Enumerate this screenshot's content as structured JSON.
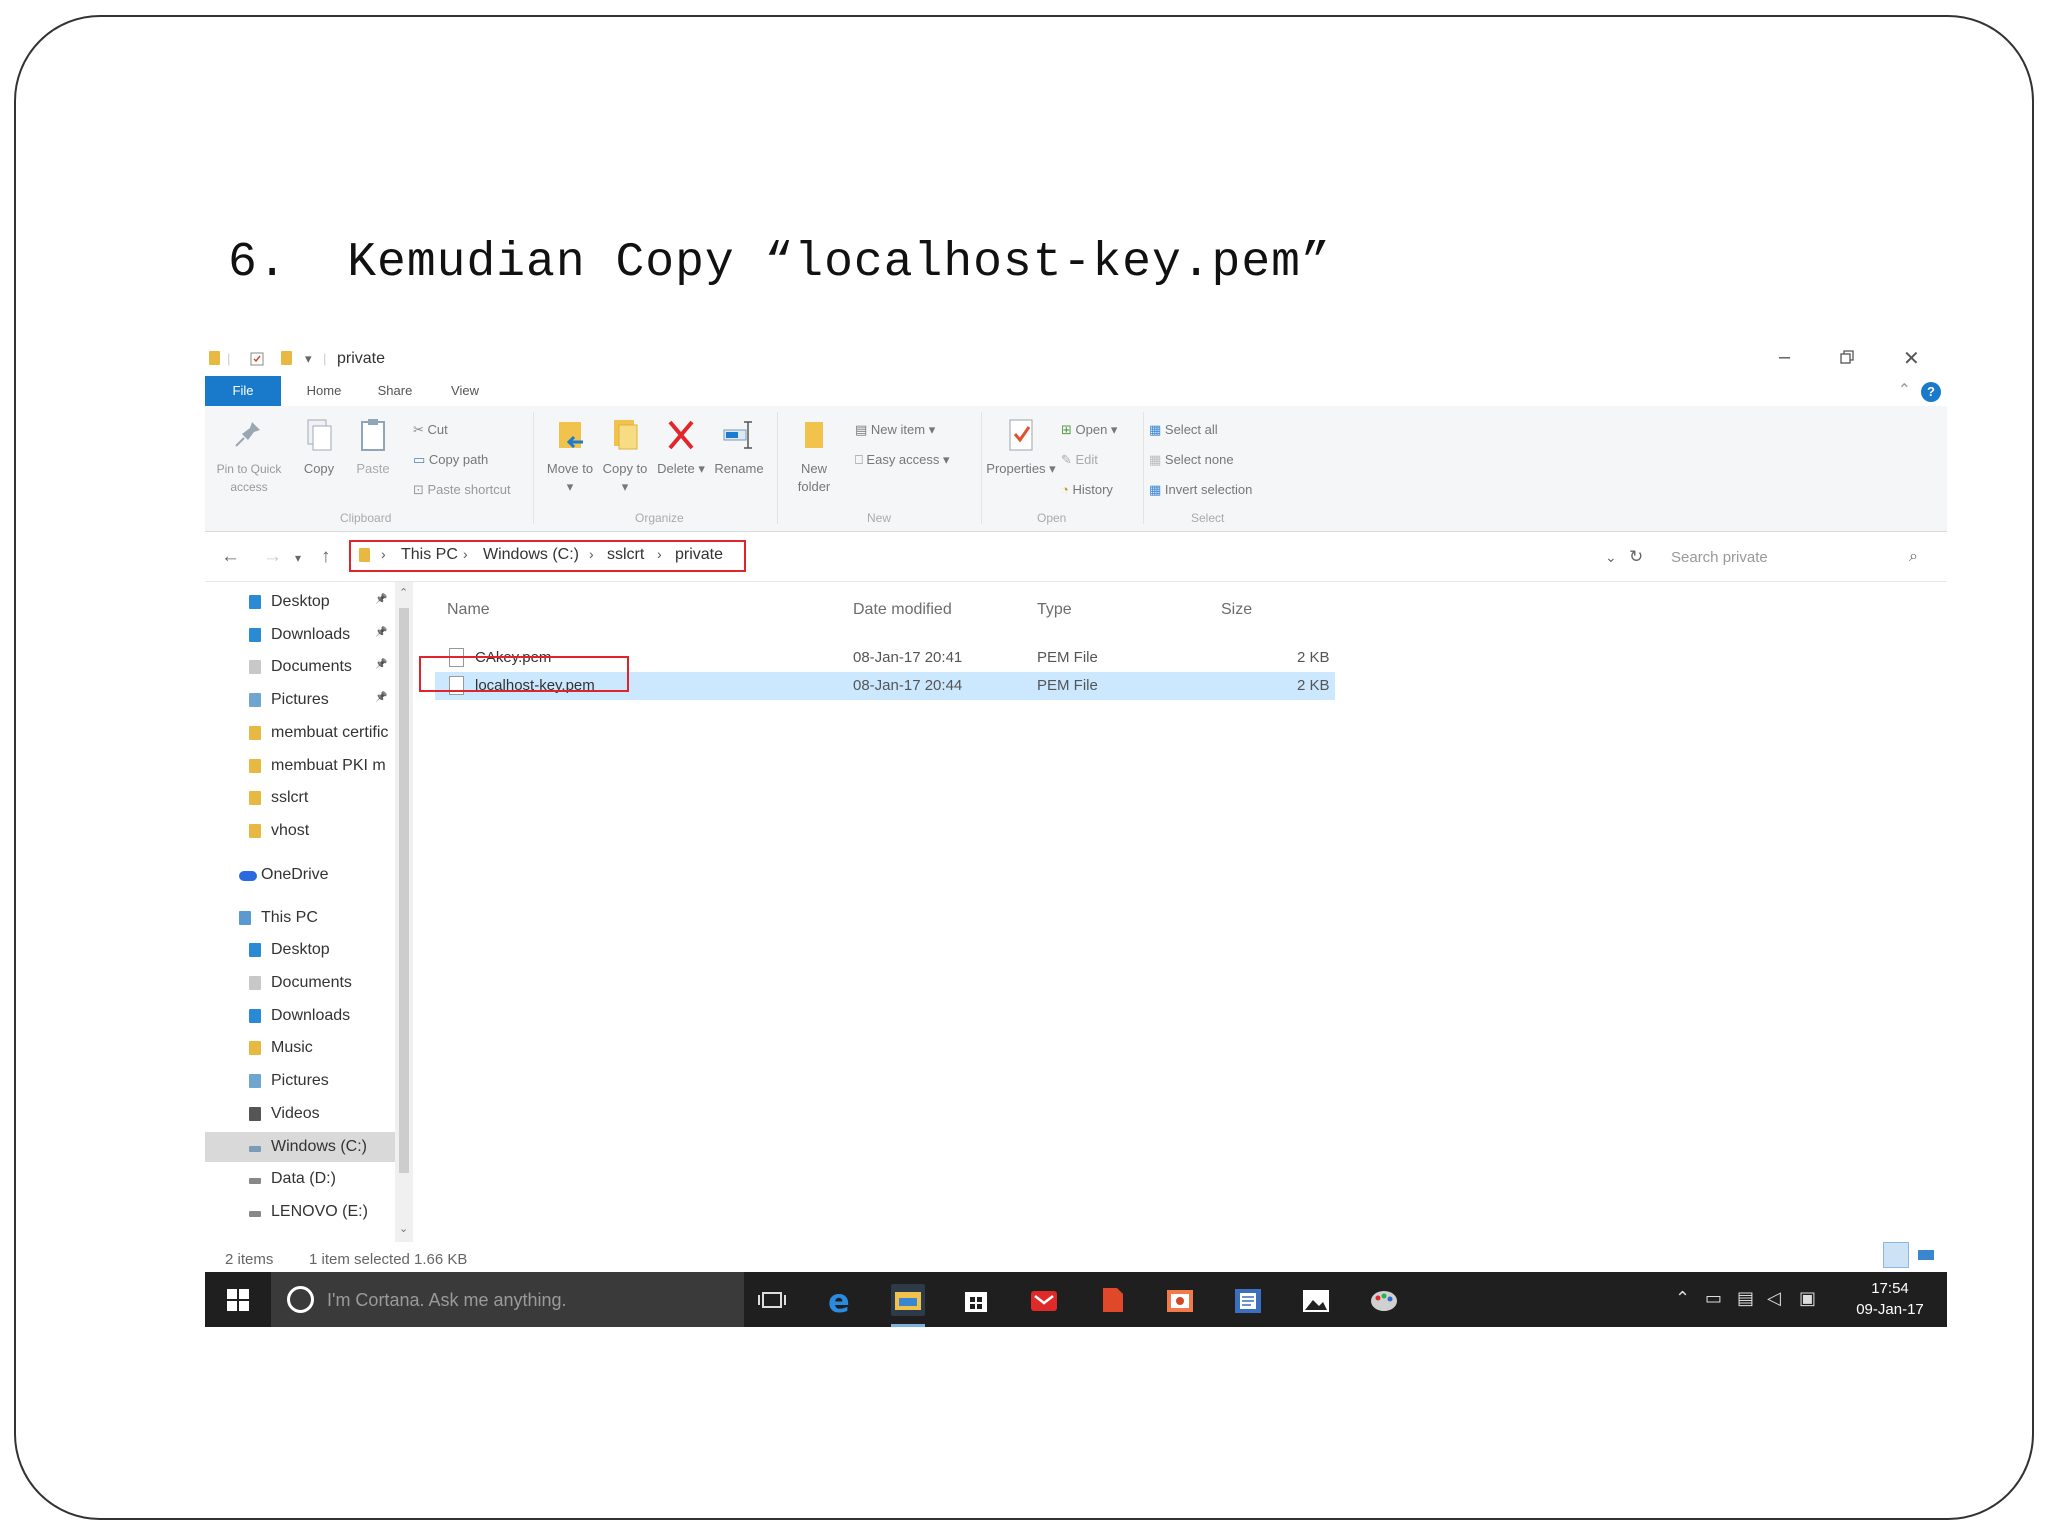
{
  "slide": {
    "title": "6.  Kemudian Copy “localhost-key.pem”"
  },
  "window": {
    "title": "private",
    "tabs": [
      "File",
      "Home",
      "Share",
      "View"
    ]
  },
  "ribbon": {
    "pin_quick_access": "Pin to Quick access",
    "copy": "Copy",
    "paste": "Paste",
    "cut": "Cut",
    "copy_path": "Copy path",
    "paste_shortcut": "Paste shortcut",
    "group_clipboard": "Clipboard",
    "move_to": "Move to ▾",
    "copy_to": "Copy to ▾",
    "delete": "Delete ▾",
    "rename": "Rename",
    "group_organize": "Organize",
    "new_folder": "New folder",
    "new_item": "New item ▾",
    "easy_access": "Easy access ▾",
    "group_new": "New",
    "properties": "Properties ▾",
    "open": "Open ▾",
    "edit": "Edit",
    "history": "History",
    "group_open": "Open",
    "select_all": "Select all",
    "select_none": "Select none",
    "invert_selection": "Invert selection",
    "group_select": "Select"
  },
  "address": {
    "crumbs": [
      "This PC",
      "Windows (C:)",
      "sslcrt",
      "private"
    ],
    "search_placeholder": "Search private"
  },
  "nav": {
    "quick": [
      {
        "label": "Desktop",
        "color": "#2a8ad4"
      },
      {
        "label": "Downloads",
        "color": "#2a8ad4"
      },
      {
        "label": "Documents",
        "color": "#c8c8c8"
      },
      {
        "label": "Pictures",
        "color": "#6fa6d0"
      },
      {
        "label": "membuat certific",
        "color": "#e7b943"
      },
      {
        "label": "membuat PKI m",
        "color": "#e7b943"
      },
      {
        "label": "sslcrt",
        "color": "#e7b943"
      },
      {
        "label": "vhost",
        "color": "#e7b943"
      }
    ],
    "onedrive": "OneDrive",
    "thispc": "This PC",
    "pc": [
      {
        "label": "Desktop",
        "color": "#2a8ad4"
      },
      {
        "label": "Documents",
        "color": "#c8c8c8"
      },
      {
        "label": "Downloads",
        "color": "#2a8ad4"
      },
      {
        "label": "Music",
        "color": "#e7b943"
      },
      {
        "label": "Pictures",
        "color": "#6fa6d0"
      },
      {
        "label": "Videos",
        "color": "#555555"
      },
      {
        "label": "Windows (C:)",
        "color": "#7a9cb8"
      },
      {
        "label": "Data (D:)",
        "color": "#888888"
      },
      {
        "label": "LENOVO (E:)",
        "color": "#888888"
      }
    ]
  },
  "files": {
    "headers": {
      "name": "Name",
      "date": "Date modified",
      "type": "Type",
      "size": "Size"
    },
    "rows": [
      {
        "name": "CAkey.pem",
        "date": "08-Jan-17 20:41",
        "type": "PEM File",
        "size": "2 KB"
      },
      {
        "name": "localhost-key.pem",
        "date": "08-Jan-17 20:44",
        "type": "PEM File",
        "size": "2 KB"
      }
    ]
  },
  "status": {
    "items": "2 items",
    "selected": "1 item selected  1.66 KB"
  },
  "taskbar": {
    "cortana": "I'm Cortana. Ask me anything.",
    "time": "17:54",
    "date": "09-Jan-17"
  },
  "colors": {
    "accent": "#1979ca",
    "highlight_box": "#e0242c",
    "selection": "#cce8ff"
  }
}
